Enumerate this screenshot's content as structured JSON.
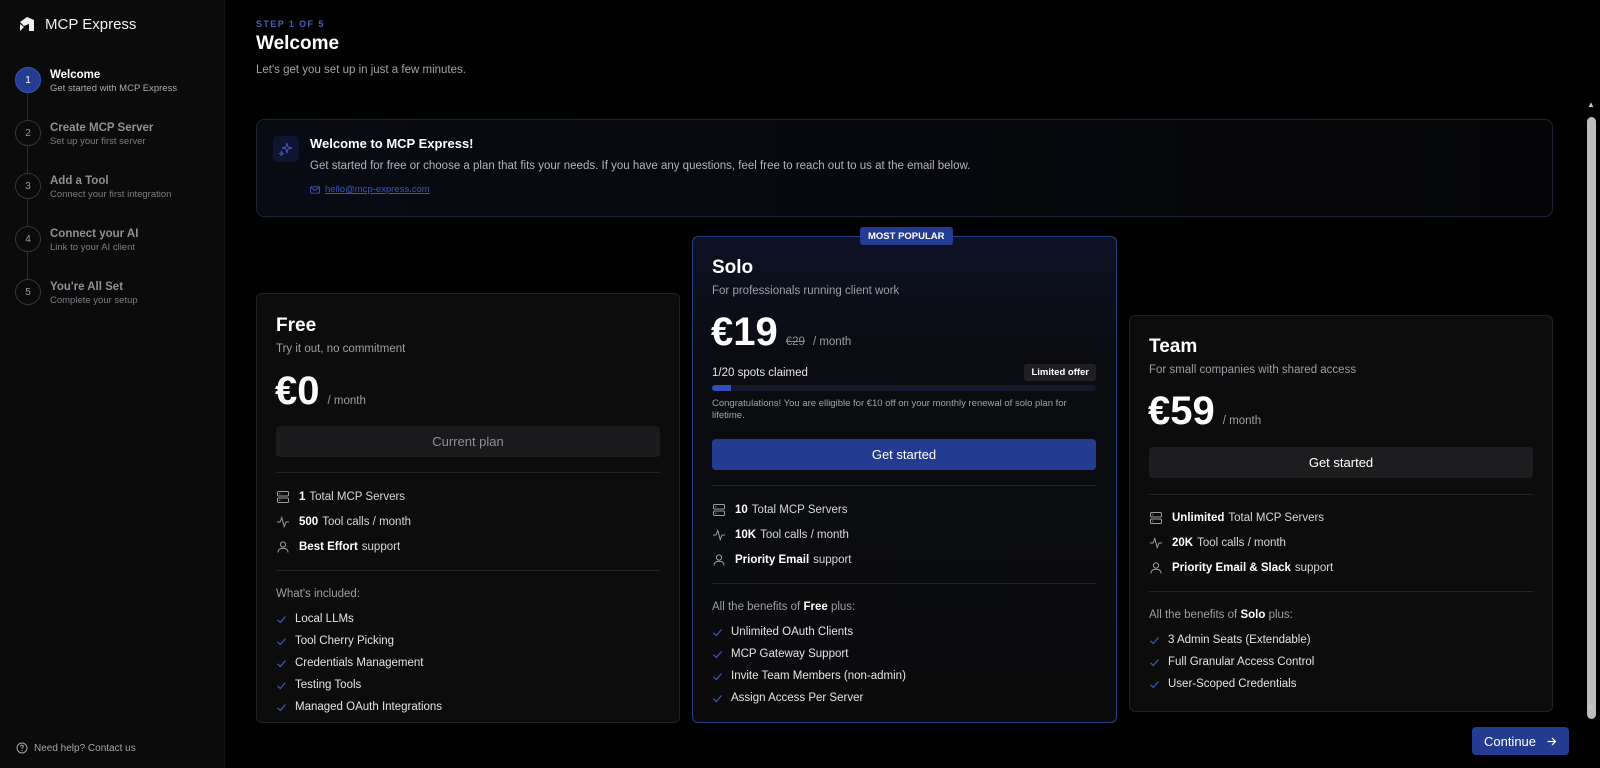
{
  "app": {
    "name": "MCP Express"
  },
  "sidebar": {
    "steps": [
      {
        "num": "1",
        "title": "Welcome",
        "subtitle": "Get started with MCP Express",
        "active": true
      },
      {
        "num": "2",
        "title": "Create MCP Server",
        "subtitle": "Set up your first server"
      },
      {
        "num": "3",
        "title": "Add a Tool",
        "subtitle": "Connect your first integration"
      },
      {
        "num": "4",
        "title": "Connect your AI",
        "subtitle": "Link to your AI client"
      },
      {
        "num": "5",
        "title": "You're All Set",
        "subtitle": "Complete your setup"
      }
    ],
    "help": "Need help? Contact us"
  },
  "header": {
    "step_label": "STEP 1 OF 5",
    "title": "Welcome",
    "subtitle": "Let's get you set up in just a few minutes."
  },
  "welcome_card": {
    "title": "Welcome to MCP Express!",
    "text": "Get started for free or choose a plan that fits your needs. If you have any questions, feel free to reach out to us at the email below.",
    "email": "hello@mcp-express.com"
  },
  "plans": {
    "free": {
      "name": "Free",
      "desc": "Try it out, no commitment",
      "price": "€0",
      "per": "/ month",
      "button": "Current plan",
      "features": [
        {
          "strong": "1",
          "rest": "Total MCP Servers",
          "icon": "server-icon"
        },
        {
          "strong": "500",
          "rest": "Tool calls / month",
          "icon": "activity-icon"
        },
        {
          "strong": "Best Effort",
          "rest": "support",
          "icon": "user-icon"
        }
      ],
      "included_heading": "What's included:",
      "included": [
        "Local LLMs",
        "Tool Cherry Picking",
        "Credentials Management",
        "Testing Tools",
        "Managed OAuth Integrations"
      ]
    },
    "solo": {
      "badge": "MOST POPULAR",
      "name": "Solo",
      "desc": "For professionals running client work",
      "price": "€19",
      "old_price": "€29",
      "per": "/ month",
      "claimed": "1/20 spots claimed",
      "claimed_fraction": 0.05,
      "limited": "Limited offer",
      "congrats": "Congratulations! You are elligible for €10 off on your monthly renewal of solo plan for lifetime.",
      "button": "Get started",
      "features": [
        {
          "strong": "10",
          "rest": "Total MCP Servers",
          "icon": "server-icon"
        },
        {
          "strong": "10K",
          "rest": "Tool calls / month",
          "icon": "activity-icon"
        },
        {
          "strong": "Priority Email",
          "rest": "support",
          "icon": "user-icon"
        }
      ],
      "benefits_pre": "All the benefits of",
      "benefits_strong": "Free",
      "benefits_post": "plus:",
      "included": [
        "Unlimited OAuth Clients",
        "MCP Gateway Support",
        "Invite Team Members (non-admin)",
        "Assign Access Per Server"
      ]
    },
    "team": {
      "name": "Team",
      "desc": "For small companies with shared access",
      "price": "€59",
      "per": "/ month",
      "button": "Get started",
      "features": [
        {
          "strong": "Unlimited",
          "rest": "Total MCP Servers",
          "icon": "server-icon"
        },
        {
          "strong": "20K",
          "rest": "Tool calls / month",
          "icon": "activity-icon"
        },
        {
          "strong": "Priority Email & Slack",
          "rest": "support",
          "icon": "user-icon"
        }
      ],
      "benefits_pre": "All the benefits of",
      "benefits_strong": "Solo",
      "benefits_post": "plus:",
      "included": [
        "3 Admin Seats (Extendable)",
        "Full Granular Access Control",
        "User-Scoped Credentials"
      ]
    }
  },
  "footer": {
    "continue": "Continue"
  },
  "colors": {
    "accent": "#233c91",
    "background": "#000000",
    "sidebar": "#0b0b0c"
  }
}
